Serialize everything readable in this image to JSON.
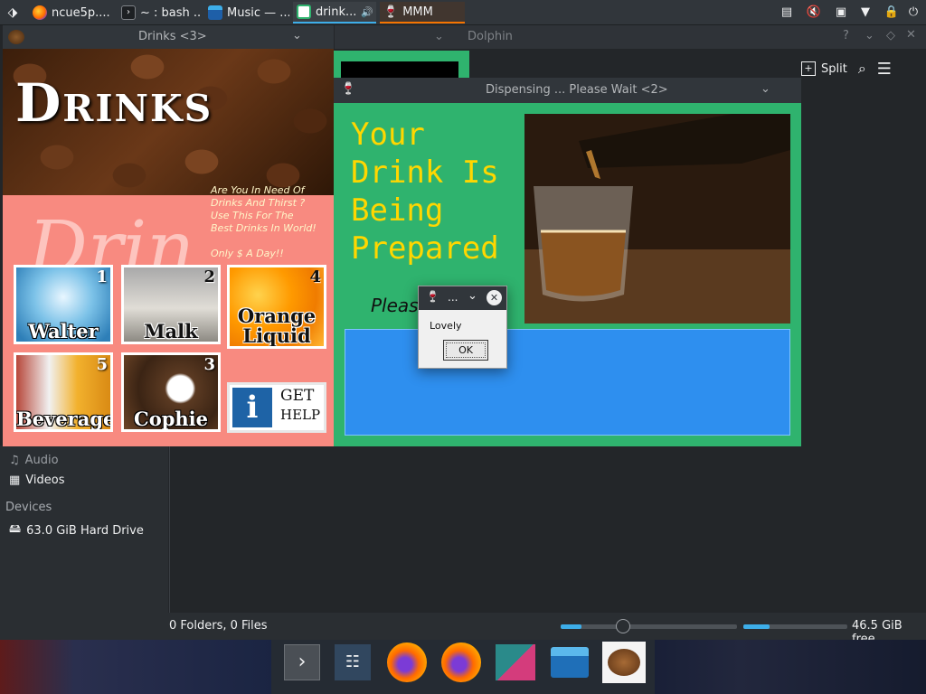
{
  "top_panel": {
    "tasks": [
      {
        "label": "ncue5p...."
      },
      {
        "label": "~ : bash ..."
      },
      {
        "label": "Music — ..."
      },
      {
        "label": "drink..."
      },
      {
        "label": "MMM"
      }
    ]
  },
  "dolphin": {
    "title": "Dolphin",
    "split_label": "Split",
    "places": [
      {
        "label": "Audio"
      },
      {
        "label": "Videos"
      }
    ],
    "devices_heading": "Devices",
    "devices": [
      {
        "label": "63.0 GiB Hard Drive"
      }
    ],
    "status_left": "0 Folders, 0 Files",
    "status_right": "46.5 GiB free",
    "zoom_level": 0.12,
    "disk_used_fraction": 0.25
  },
  "drinks": {
    "title": "Drinks <3>",
    "logo": "Drinks",
    "bigtext": "Drin",
    "promo_lines": [
      "Are You In Need Of",
      "Drinks And Thirst ?",
      "Use This For The",
      "Best Drinks In World!",
      "",
      "Only $ A Day!!"
    ],
    "tiles": [
      {
        "label": "Walter",
        "num": "1"
      },
      {
        "label": "Malk",
        "num": "2"
      },
      {
        "label": "Orange Liquid",
        "num": "4"
      },
      {
        "label": "Beverage",
        "num": "5"
      },
      {
        "label": "Cophie",
        "num": "3"
      }
    ],
    "help_line1": "GET",
    "help_line2": "HELP"
  },
  "dispensing": {
    "title": "Dispensing ... Please Wait <2>",
    "headline_lines": [
      "Your",
      "Drink Is",
      "Being",
      "Prepared"
    ],
    "please": "Please"
  },
  "dialog": {
    "title": "...",
    "message": "Lovely",
    "ok_label": "OK"
  }
}
